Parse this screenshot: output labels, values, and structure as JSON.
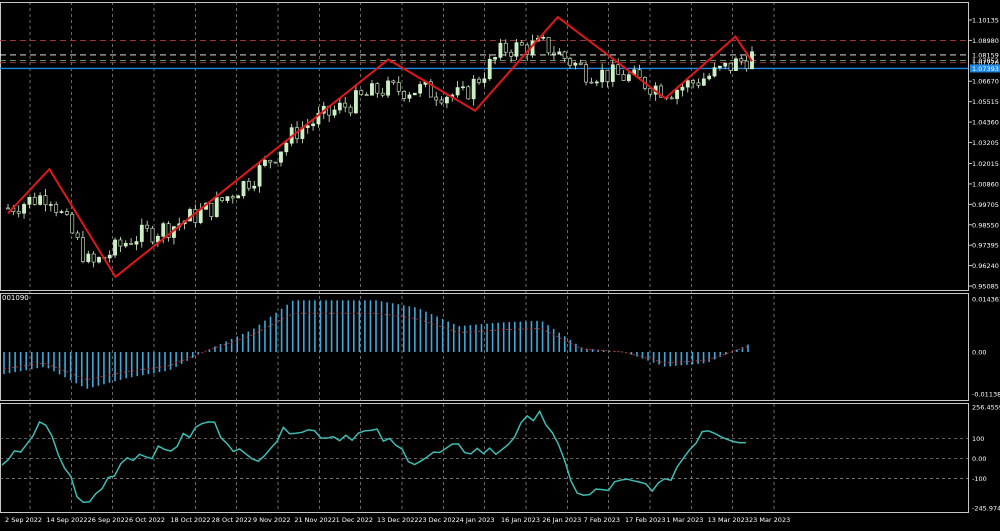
{
  "colors": {
    "background": "#000000",
    "frame": "#c8c8c8",
    "grid": "#9a9a9a",
    "text": "#ffffff",
    "zigzag": "#e01818",
    "macd_hist": "#3fa9dc",
    "macd_signal": "#b5312f",
    "cci_line": "#3fbcb4",
    "candle_bull_body": "#c8f0c0",
    "candle_bear_body": "#000000",
    "candle_wick": "#d8f5d0",
    "current_price_label": "#1e88e5"
  },
  "main_panel": {
    "price_axis": [
      "1.10135",
      "1.08980",
      "1.06670",
      "1.05515",
      "1.04360",
      "1.03205",
      "1.02015",
      "1.00860",
      "0.99705",
      "0.98550",
      "0.97395",
      "0.96240",
      "0.95085"
    ],
    "price_range": [
      0.95085,
      1.10135
    ],
    "labels": [
      "1.08159",
      "1.07852",
      "1.07720",
      "1.07393"
    ]
  },
  "macd_panel": {
    "label": "001090",
    "axis": [
      "0.014361",
      "0.00",
      "-0.011383"
    ]
  },
  "cci_panel": {
    "axis": [
      "256.4559",
      "100",
      "0.00",
      "-100",
      "-245.9740"
    ]
  },
  "time_axis": [
    "2 Sep 2022",
    "14 Sep 2022",
    "26 Sep 2022",
    "6 Oct 2022",
    "18 Oct 2022",
    "28 Oct 2022",
    "9 Nov 2022",
    "21 Nov 2022",
    "1 Dec 2022",
    "13 Dec 2022",
    "23 Dec 2022",
    "4 Jan 2023",
    "16 Jan 2023",
    "26 Jan 2023",
    "7 Feb 2023",
    "17 Feb 2023",
    "1 Mar 2023",
    "13 Mar 2023",
    "23 Mar 2023"
  ],
  "chart_data": {
    "type": "line",
    "title": "",
    "xlabel": "",
    "ylabel": "",
    "ylim": [
      0.95085,
      1.10135
    ],
    "grid": true,
    "x": [
      "2 Sep 2022",
      "14 Sep 2022",
      "26 Sep 2022",
      "6 Oct 2022",
      "18 Oct 2022",
      "28 Oct 2022",
      "9 Nov 2022",
      "21 Nov 2022",
      "1 Dec 2022",
      "13 Dec 2022",
      "23 Dec 2022",
      "4 Jan 2023",
      "16 Jan 2023",
      "26 Jan 2023",
      "7 Feb 2023",
      "17 Feb 2023",
      "1 Mar 2023",
      "13 Mar 2023",
      "23 Mar 2023"
    ],
    "close_approx": [
      0.995,
      1.003,
      0.962,
      0.978,
      0.985,
      0.996,
      1.014,
      1.039,
      1.051,
      1.062,
      1.062,
      1.058,
      1.085,
      1.087,
      1.072,
      1.069,
      1.061,
      1.07,
      1.081
    ],
    "series": [
      {
        "values": [
          0.992,
          1.017,
          0.956,
          0.974,
          0.991,
          1.018,
          1.039,
          1.052,
          1.066,
          1.08,
          1.062,
          1.05,
          1.078,
          1.103,
          1.08,
          1.069,
          1.057,
          1.079,
          1.092
        ]
      }
    ],
    "macd_values": [
      -0.006,
      -0.004,
      -0.01,
      -0.007,
      -0.005,
      0.001,
      0.006,
      0.014,
      0.014,
      0.014,
      0.012,
      0.007,
      0.008,
      0.0085,
      0.001,
      0.0,
      -0.004,
      -0.003,
      0.002
    ],
    "cci_values": [
      -60,
      180,
      -250,
      10,
      40,
      190,
      -20,
      160,
      110,
      130,
      -10,
      50,
      30,
      250,
      -200,
      -120,
      -140,
      160,
      80
    ]
  }
}
